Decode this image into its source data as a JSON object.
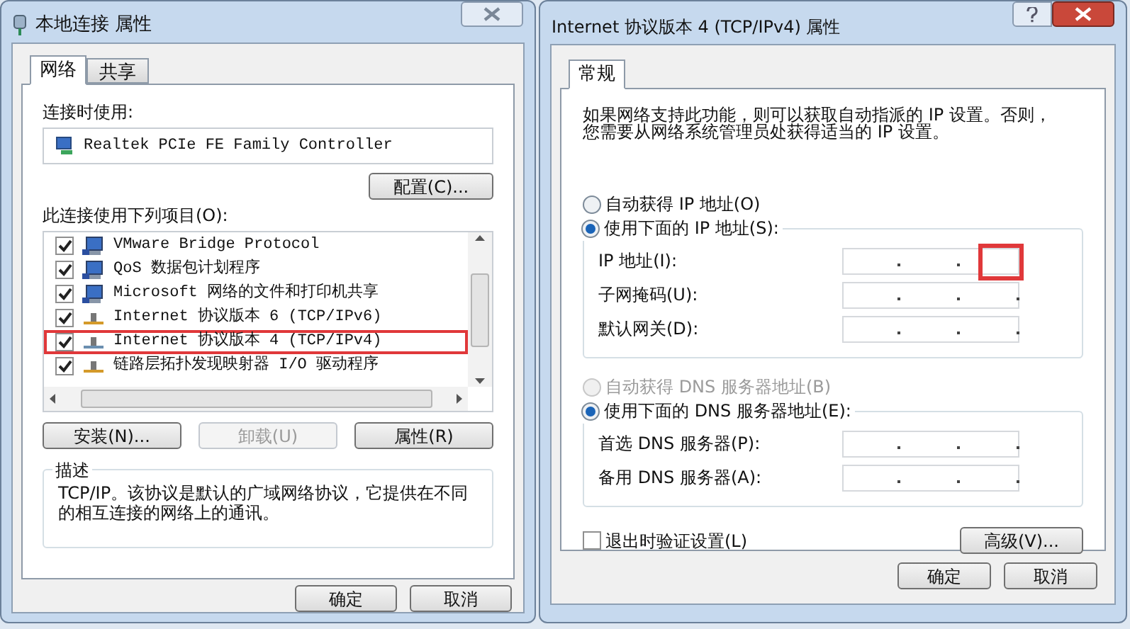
{
  "network_window": {
    "title": "本地连接 属性",
    "tabs": [
      {
        "label": "网络",
        "selected": true
      },
      {
        "label": "共享",
        "selected": false
      }
    ],
    "connect_using_label": "连接时使用:",
    "adapter": "Realtek PCIe FE Family Controller",
    "configure_button": "配置(C)...",
    "items_label": "此连接使用下列项目(O):",
    "items": [
      {
        "label": "VMware Bridge Protocol",
        "checked": true,
        "kind": "service",
        "highlighted": false
      },
      {
        "label": "QoS 数据包计划程序",
        "checked": true,
        "kind": "service",
        "highlighted": false
      },
      {
        "label": "Microsoft 网络的文件和打印机共享",
        "checked": true,
        "kind": "service",
        "highlighted": false
      },
      {
        "label": "Internet 协议版本 6 (TCP/IPv6)",
        "checked": true,
        "kind": "protocol",
        "highlighted": false
      },
      {
        "label": "Internet 协议版本 4 (TCP/IPv4)",
        "checked": true,
        "kind": "protocol",
        "highlighted": true
      },
      {
        "label": "链路层拓扑发现映射器 I/O 驱动程序",
        "checked": true,
        "kind": "protocol",
        "highlighted": false
      }
    ],
    "buttons": [
      {
        "label": "安装(N)...",
        "disabled": false
      },
      {
        "label": "卸载(U)",
        "disabled": true
      },
      {
        "label": "属性(R)",
        "disabled": false
      }
    ],
    "description": {
      "title": "描述",
      "text": "TCP/IP。该协议是默认的广域网络协议，它提供在不同的相互连接的网络上的通讯。"
    },
    "footer_buttons": [
      "确定",
      "取消"
    ]
  },
  "ipv4_window": {
    "title": "Internet 协议版本 4 (TCP/IPv4) 属性",
    "tabs": [
      {
        "label": "常规",
        "selected": true
      }
    ],
    "intro": "如果网络支持此功能，则可以获取自动指派的 IP 设置。否则，您需要从网络系统管理员处获得适当的 IP 设置。",
    "ip_modes": [
      {
        "label": "自动获得 IP 地址(O)",
        "selected": false,
        "disabled": false
      },
      {
        "label": "使用下面的 IP 地址(S):",
        "selected": true,
        "disabled": false
      }
    ],
    "ip_fields": [
      {
        "label": "IP 地址(I):",
        "highlighted": true
      },
      {
        "label": "子网掩码(U):",
        "highlighted": false
      },
      {
        "label": "默认网关(D):",
        "highlighted": false
      }
    ],
    "dns_modes": [
      {
        "label": "自动获得 DNS 服务器地址(B)",
        "selected": false,
        "disabled": true
      },
      {
        "label": "使用下面的 DNS 服务器地址(E):",
        "selected": true,
        "disabled": false
      }
    ],
    "dns_fields": [
      {
        "label": "首选 DNS 服务器(P):",
        "highlighted": false
      },
      {
        "label": "备用 DNS 服务器(A):",
        "highlighted": false
      }
    ],
    "validate": {
      "label": "退出时验证设置(L)",
      "checked": false
    },
    "advanced_button": "高级(V)...",
    "footer_buttons": [
      "确定",
      "取消"
    ]
  }
}
